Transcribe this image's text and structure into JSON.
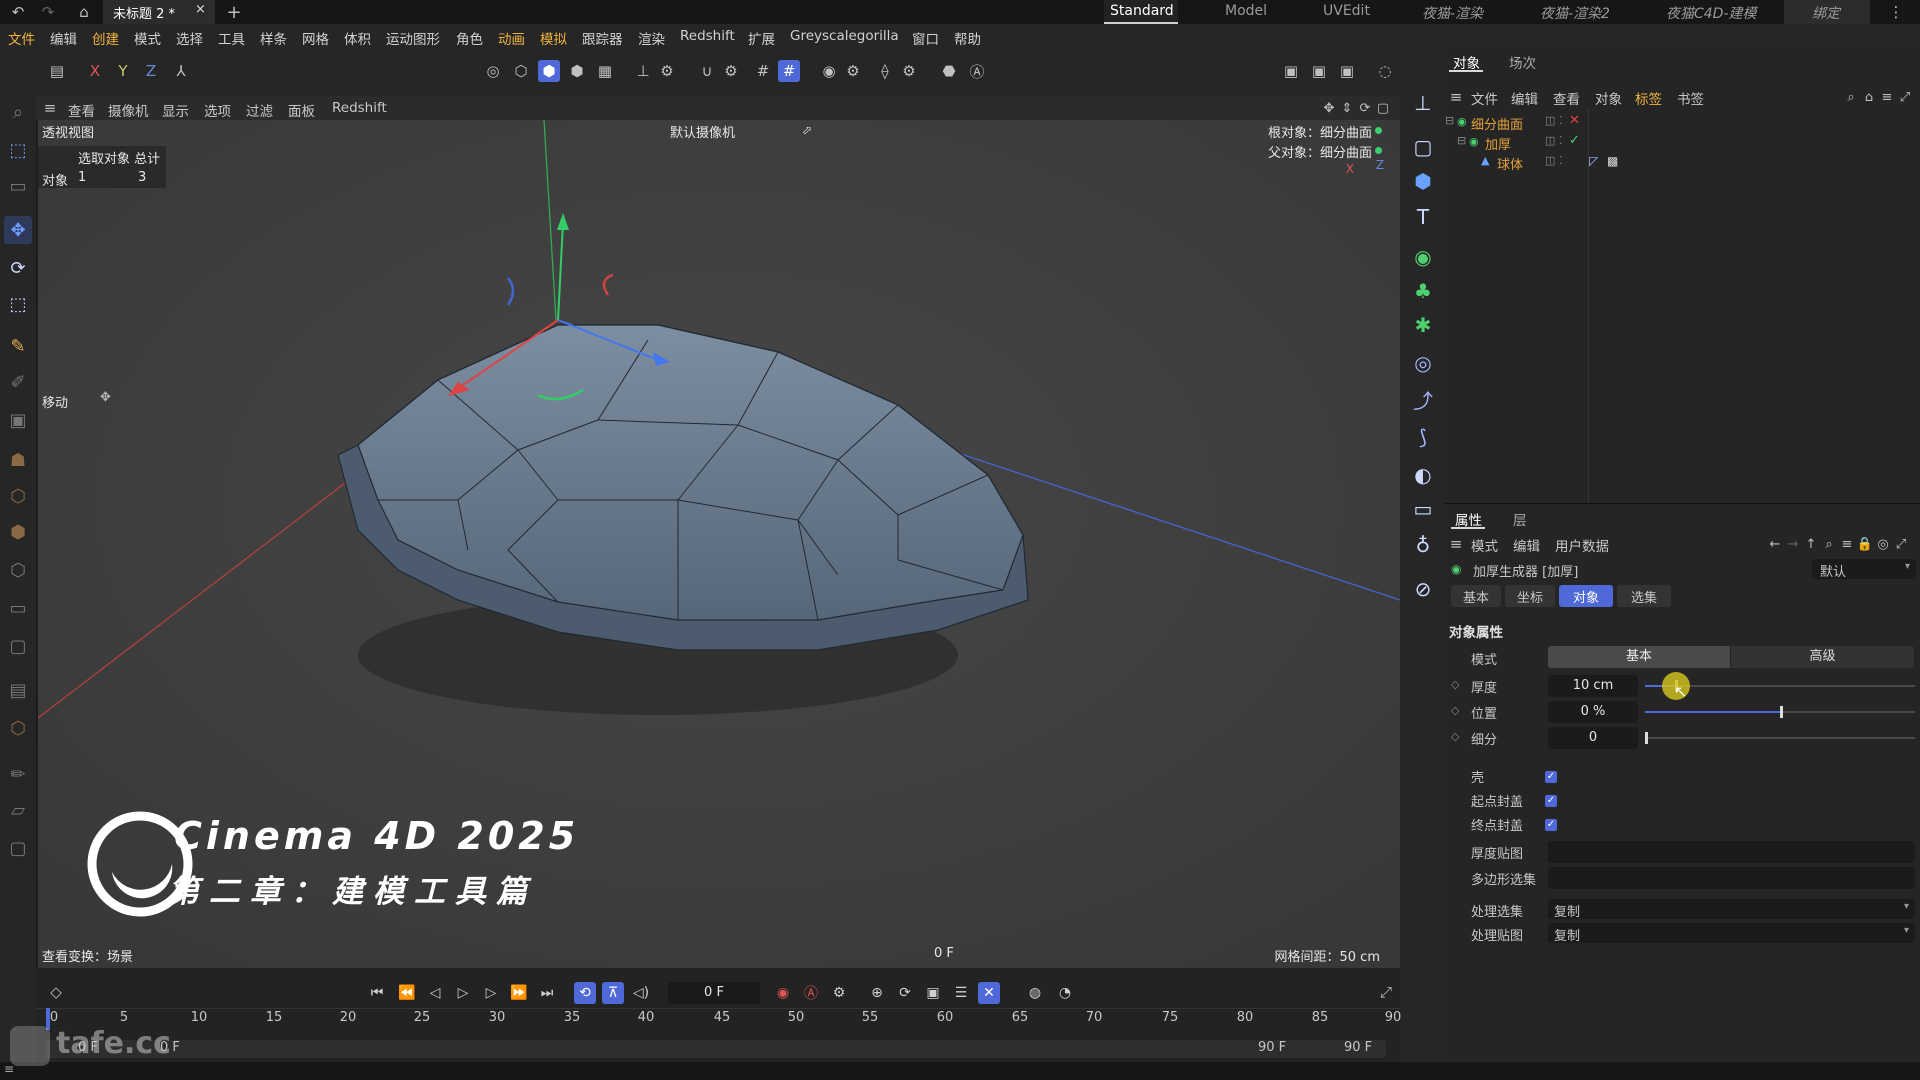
{
  "titlebar": {
    "doc_tab": "未标题 2 *",
    "workspaces": [
      "Standard",
      "Model",
      "UVEdit",
      "夜猫-渲染",
      "夜猫-渲染2",
      "夜猫C4D-建模",
      "绑定"
    ],
    "active_workspace": "Standard"
  },
  "menu": [
    "文件",
    "编辑",
    "创建",
    "模式",
    "选择",
    "工具",
    "样条",
    "网格",
    "体积",
    "运动图形",
    "角色",
    "动画",
    "模拟",
    "跟踪器",
    "渲染",
    "Redshift",
    "扩展",
    "Greyscalegorilla",
    "窗口",
    "帮助"
  ],
  "toolbar": {
    "axis_x": "X",
    "axis_y": "Y",
    "axis_z": "Z"
  },
  "viewport_menu": [
    "查看",
    "摄像机",
    "显示",
    "选项",
    "过滤",
    "面板",
    "Redshift"
  ],
  "viewport": {
    "view_name": "透视视图",
    "camera": "默认摄像机",
    "root_object": "根对象：细分曲面",
    "parent_object": "父对象：细分曲面",
    "stats_header": "选取对象 总计",
    "stats_label": "对象",
    "stats_selected": "1",
    "stats_total": "3",
    "tool_label": "移动",
    "view_transform": "查看变换：场景",
    "frame": "0 F",
    "grid_spacing": "网格间距：50 cm",
    "watermark_title": "Cinema 4D 2025",
    "watermark_sub": "第二章：建模工具篇",
    "axis_x_label": "X",
    "axis_z_label": "Z"
  },
  "object_panel": {
    "tabs": [
      "对象",
      "场次"
    ],
    "menu": [
      "文件",
      "编辑",
      "查看",
      "对象",
      "标签",
      "书签"
    ],
    "tree": [
      {
        "name": "细分曲面",
        "color": "#e3a23a"
      },
      {
        "name": "加厚",
        "color": "#e3a23a"
      },
      {
        "name": "球体",
        "color": "#e3a23a"
      }
    ]
  },
  "attributes": {
    "tabs": [
      "属性",
      "层"
    ],
    "menu": [
      "模式",
      "编辑",
      "用户数据"
    ],
    "object_title": "加厚生成器 [加厚]",
    "preset": "默认",
    "subtabs": [
      "基本",
      "坐标",
      "对象",
      "选集"
    ],
    "active_subtab": "对象",
    "section": "对象属性",
    "mode_label": "模式",
    "mode_options": [
      "基本",
      "高级"
    ],
    "params": [
      {
        "label": "厚度",
        "value": "10 cm",
        "fill": 0.11
      },
      {
        "label": "位置",
        "value": "0 %",
        "fill": 0.5
      },
      {
        "label": "细分",
        "value": "0",
        "fill": 0.0
      }
    ],
    "checks": [
      {
        "label": "壳",
        "checked": true
      },
      {
        "label": "起点封盖",
        "checked": true
      },
      {
        "label": "终点封盖",
        "checked": true
      }
    ],
    "fields": [
      {
        "label": "厚度贴图",
        "value": ""
      },
      {
        "label": "多边形选集",
        "value": ""
      }
    ],
    "dropdowns": [
      {
        "label": "处理选集",
        "value": "复制"
      },
      {
        "label": "处理贴图",
        "value": "复制"
      }
    ]
  },
  "timeline": {
    "current": "0 F",
    "ticks": [
      "0",
      "5",
      "10",
      "15",
      "20",
      "25",
      "30",
      "35",
      "40",
      "45",
      "50",
      "55",
      "60",
      "65",
      "70",
      "75",
      "80",
      "85",
      "90"
    ],
    "start": "0 F",
    "start2": "0 F",
    "end": "90 F",
    "end2": "90 F"
  },
  "logo_watermark": "tafe.cc",
  "colors": {
    "accent": "#4f6ad8",
    "ui_bg": "#262626",
    "viewport_bg": "#3e3e3e",
    "mesh": "#5f7083"
  }
}
